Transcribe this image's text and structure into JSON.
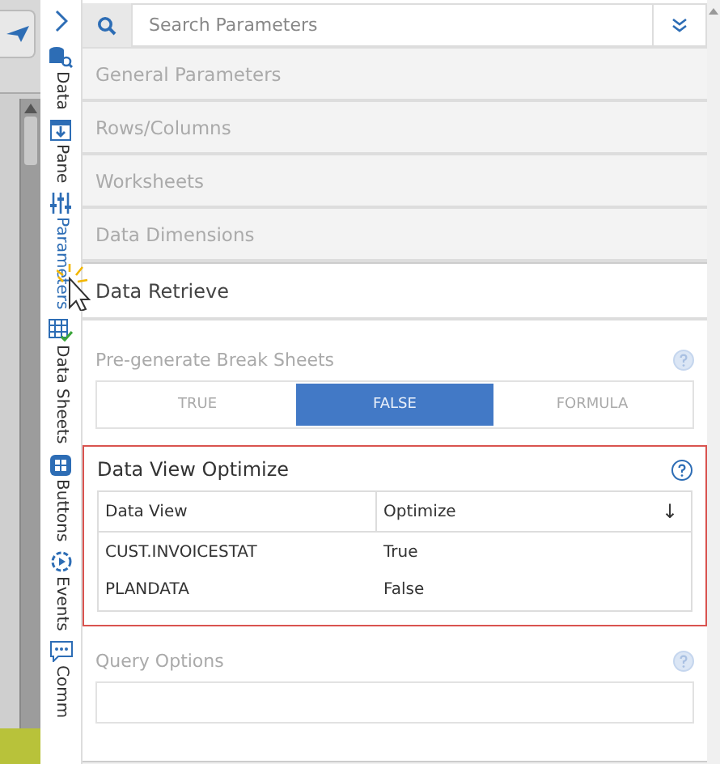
{
  "side_tabs": [
    {
      "label": "Data",
      "kind": "database",
      "selected": false
    },
    {
      "label": "Pane",
      "kind": "pane",
      "selected": false
    },
    {
      "label": "Parameters",
      "kind": "sliders",
      "selected": true
    },
    {
      "label": "Data Sheets",
      "kind": "grid",
      "selected": false
    },
    {
      "label": "Buttons",
      "kind": "buttons",
      "selected": false
    },
    {
      "label": "Events",
      "kind": "events",
      "selected": false
    },
    {
      "label": "Comm",
      "kind": "comment",
      "selected": false
    }
  ],
  "search": {
    "placeholder": "Search Parameters"
  },
  "sections": [
    {
      "title": "General Parameters",
      "disabled": true,
      "expanded": false
    },
    {
      "title": "Rows/Columns",
      "disabled": true,
      "expanded": false
    },
    {
      "title": "Worksheets",
      "disabled": true,
      "expanded": false
    },
    {
      "title": "Data Dimensions",
      "disabled": true,
      "expanded": false
    },
    {
      "title": "Data Retrieve",
      "disabled": false,
      "expanded": true
    }
  ],
  "break_sheets": {
    "label": "Pre-generate Break Sheets",
    "disabled": true,
    "options": [
      {
        "label": "TRUE",
        "selected": false
      },
      {
        "label": "FALSE",
        "selected": true
      },
      {
        "label": "FORMULA",
        "selected": false
      }
    ]
  },
  "optimize": {
    "title": "Data View Optimize",
    "highlighted": true,
    "columns": [
      "Data View",
      "Optimize"
    ],
    "sort_icon": "↓",
    "rows": [
      [
        "CUST.INVOICESTAT",
        "True"
      ],
      [
        "PLANDATA",
        "False"
      ]
    ]
  },
  "query_options": {
    "label": "Query Options",
    "disabled": true
  }
}
